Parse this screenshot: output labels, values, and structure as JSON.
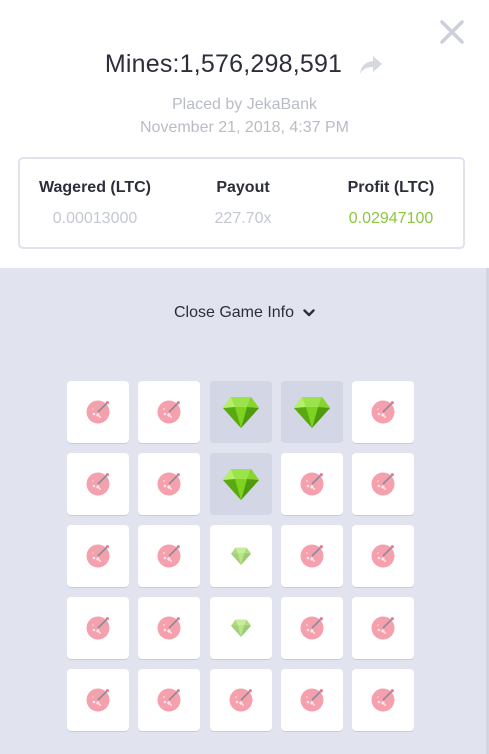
{
  "header": {
    "title": "Mines:1,576,298,591",
    "placed_by": "Placed by JekaBank",
    "date": "November 21, 2018, 4:37 PM",
    "close_icon": "close-icon",
    "share_icon": "share-icon"
  },
  "stats": {
    "wagered_label": "Wagered (LTC)",
    "wagered_value": "0.00013000",
    "payout_label": "Payout",
    "payout_value": "227.70x",
    "profit_label": "Profit (LTC)",
    "profit_value": "0.02947100"
  },
  "toggle": {
    "label": "Close Game Info",
    "icon": "chevron-down-icon"
  },
  "colors": {
    "accent_green": "#8cc63f",
    "gem": "#7ed321",
    "mine": "#f5a0ad",
    "panel": "#e1e3ee"
  },
  "grid": {
    "rows": 5,
    "cols": 5,
    "cells": [
      "mine",
      "mine",
      "gem-revealed",
      "gem-revealed",
      "mine",
      "mine",
      "mine",
      "gem-revealed",
      "mine",
      "mine",
      "mine",
      "mine",
      "gem",
      "mine",
      "mine",
      "mine",
      "mine",
      "gem",
      "mine",
      "mine",
      "mine",
      "mine",
      "mine",
      "mine",
      "mine"
    ]
  }
}
